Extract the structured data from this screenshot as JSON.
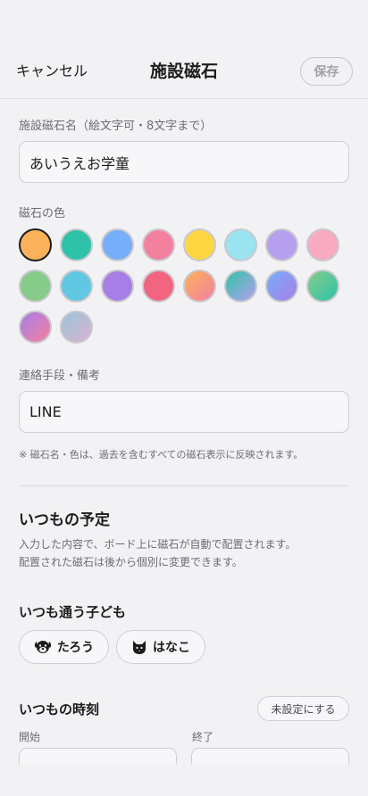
{
  "header": {
    "cancel_label": "キャンセル",
    "title": "施設磁石",
    "save_label": "保存"
  },
  "name_field": {
    "label": "施設磁石名（絵文字可・8文字まで）",
    "value": "あいうえお学童"
  },
  "color_section": {
    "label": "磁石の色",
    "selected_index": 0,
    "swatches": [
      "#fbb15a",
      "#2ec3a8",
      "#76aefb",
      "#f4809f",
      "#fdd642",
      "#9ae3f0",
      "#b6a0ee",
      "#f9a9c0",
      "#86cb8a",
      "#60c8e3",
      "#a77ee6",
      "#f2647f",
      "linear-gradient(135deg,#fbb15a,#f4809f)",
      "linear-gradient(135deg,#2ec3a8,#b6a0ee)",
      "linear-gradient(135deg,#76aefb,#a77ee6)",
      "linear-gradient(135deg,#86cb8a,#2ec3a8)",
      "linear-gradient(135deg,#a77ee6,#f4809f)",
      "linear-gradient(135deg,#9ac4d8,#d8b4d0)"
    ]
  },
  "contact_field": {
    "label": "連絡手段・備考",
    "value": "LINE"
  },
  "note": "※ 磁石名・色は、過去を含むすべての磁石表示に反映されます。",
  "schedule": {
    "title": "いつもの予定",
    "desc_line1": "入力した内容で、ボード上に磁石が自動で配置されます。",
    "desc_line2": "配置された磁石は後から個別に変更できます。",
    "children_title": "いつも通う子ども",
    "children": [
      {
        "icon": "dog-face-icon",
        "name": "たろう"
      },
      {
        "icon": "cat-face-icon",
        "name": "はなこ"
      }
    ],
    "time_title": "いつもの時刻",
    "unset_label": "未設定にする",
    "start_label": "開始",
    "end_label": "終了"
  }
}
